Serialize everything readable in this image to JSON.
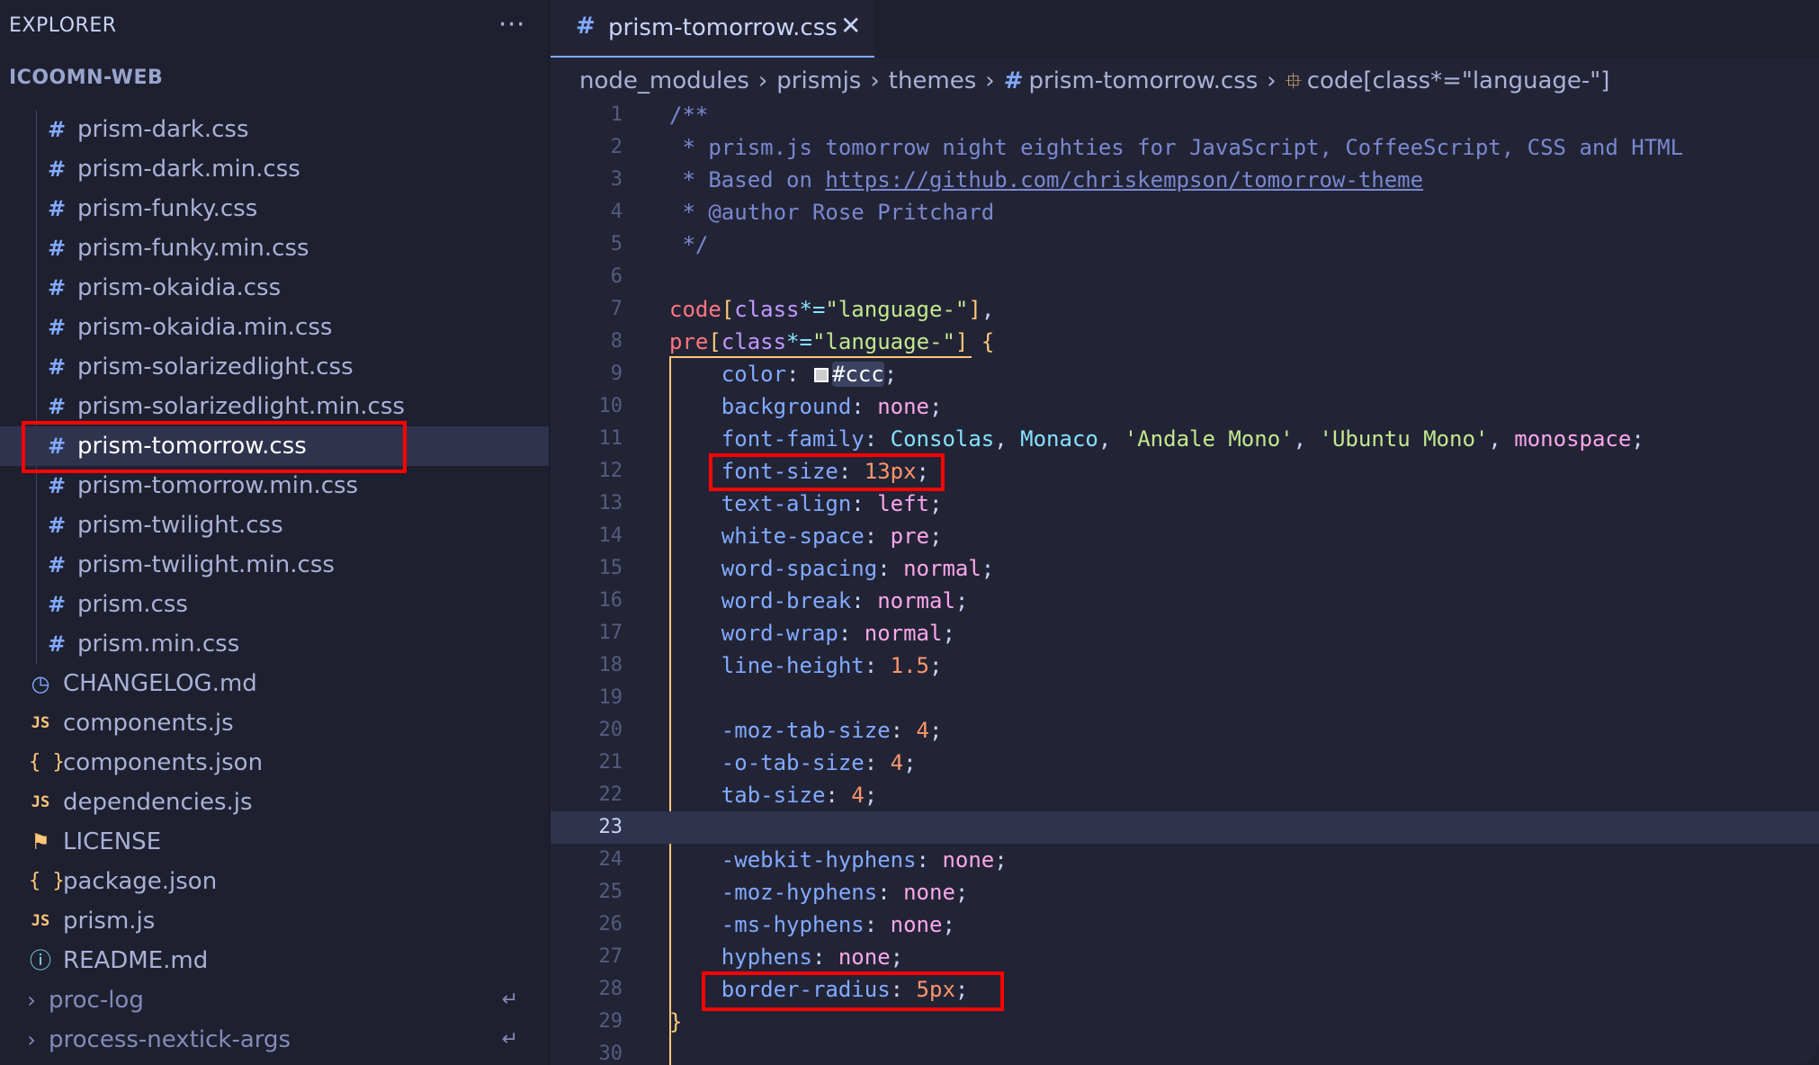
{
  "sidebar": {
    "header": "EXPLORER",
    "more_icon": "···",
    "project": "ICOOMN-WEB",
    "theme_files": [
      "prism-dark.css",
      "prism-dark.min.css",
      "prism-funky.css",
      "prism-funky.min.css",
      "prism-okaidia.css",
      "prism-okaidia.min.css",
      "prism-solarizedlight.css",
      "prism-solarizedlight.min.css",
      "prism-tomorrow.css",
      "prism-tomorrow.min.css",
      "prism-twilight.css",
      "prism-twilight.min.css",
      "prism.css",
      "prism.min.css"
    ],
    "selected_file": "prism-tomorrow.css",
    "root_files": [
      {
        "name": "CHANGELOG.md",
        "icon": "◷"
      },
      {
        "name": "components.js",
        "icon": "JS"
      },
      {
        "name": "components.json",
        "icon": "{ }"
      },
      {
        "name": "dependencies.js",
        "icon": "JS"
      },
      {
        "name": "LICENSE",
        "icon": "⚑"
      },
      {
        "name": "package.json",
        "icon": "{ }"
      },
      {
        "name": "prism.js",
        "icon": "JS"
      },
      {
        "name": "README.md",
        "icon": "ⓘ"
      }
    ],
    "folders": [
      {
        "name": "proc-log",
        "icon": "›",
        "link": "↵"
      },
      {
        "name": "process-nextick-args",
        "icon": "›",
        "link": "↵"
      }
    ]
  },
  "editor": {
    "tab": {
      "icon": "#",
      "name": "prism-tomorrow.css",
      "close": "✕"
    },
    "breadcrumb": {
      "parts": [
        "node_modules",
        "prismjs",
        "themes"
      ],
      "file_icon": "#",
      "file": "prism-tomorrow.css",
      "symbol_icon": "⯐",
      "symbol": "code[class*=\"language-\"]",
      "separator": "›"
    },
    "current_line": 23,
    "line_numbers": [
      "1",
      "2",
      "3",
      "4",
      "5",
      "6",
      "7",
      "8",
      "9",
      "10",
      "11",
      "12",
      "13",
      "14",
      "15",
      "16",
      "17",
      "18",
      "19",
      "20",
      "21",
      "22",
      "23",
      "24",
      "25",
      "26",
      "27",
      "28",
      "29",
      "30"
    ],
    "code": {
      "l1": "/**",
      "l2": " * prism.js tomorrow night eighties for JavaScript, CoffeeScript, CSS and HTML",
      "l3_pre": " * Based on ",
      "l3_url": "https://github.com/chriskempson/tomorrow-theme",
      "l4": " * @author Rose Pritchard",
      "l5": " */",
      "l7_sel": "code",
      "l8_sel": "pre",
      "attr": "class",
      "op": "*=",
      "str": "\"language-\"",
      "br_open": "[",
      "br_close": "]",
      "comma": ",",
      "brace_open": " {",
      "brace_close": "}",
      "p_color": "color",
      "v_color": "#ccc",
      "p_background": "background",
      "v_background": "none",
      "p_font_family": "font-family",
      "v_ff1": "Consolas",
      "v_ff2": "Monaco",
      "v_ff3": "'Andale Mono'",
      "v_ff4": "'Ubuntu Mono'",
      "v_ff5": "monospace",
      "p_font_size": "font-size",
      "v_font_size": "13px",
      "p_text_align": "text-align",
      "v_text_align": "left",
      "p_white_space": "white-space",
      "v_white_space": "pre",
      "p_word_spacing": "word-spacing",
      "v_word_spacing": "normal",
      "p_word_break": "word-break",
      "v_word_break": "normal",
      "p_word_wrap": "word-wrap",
      "v_word_wrap": "normal",
      "p_line_height": "line-height",
      "v_line_height": "1.5",
      "p_moz_tab": "-moz-tab-size",
      "v_moz_tab": "4",
      "p_o_tab": "-o-tab-size",
      "v_o_tab": "4",
      "p_tab": "tab-size",
      "v_tab": "4",
      "p_webkit_hyph": "-webkit-hyphens",
      "v_webkit_hyph": "none",
      "p_moz_hyph": "-moz-hyphens",
      "v_moz_hyph": "none",
      "p_ms_hyph": "-ms-hyphens",
      "v_ms_hyph": "none",
      "p_hyph": "hyphens",
      "v_hyph": "none",
      "p_border_radius": "border-radius",
      "v_border_radius": "5px"
    }
  },
  "colors": {
    "highlight_box": "#ff0000",
    "accent": "#82aaff",
    "scope_guide": "#ffc777"
  }
}
